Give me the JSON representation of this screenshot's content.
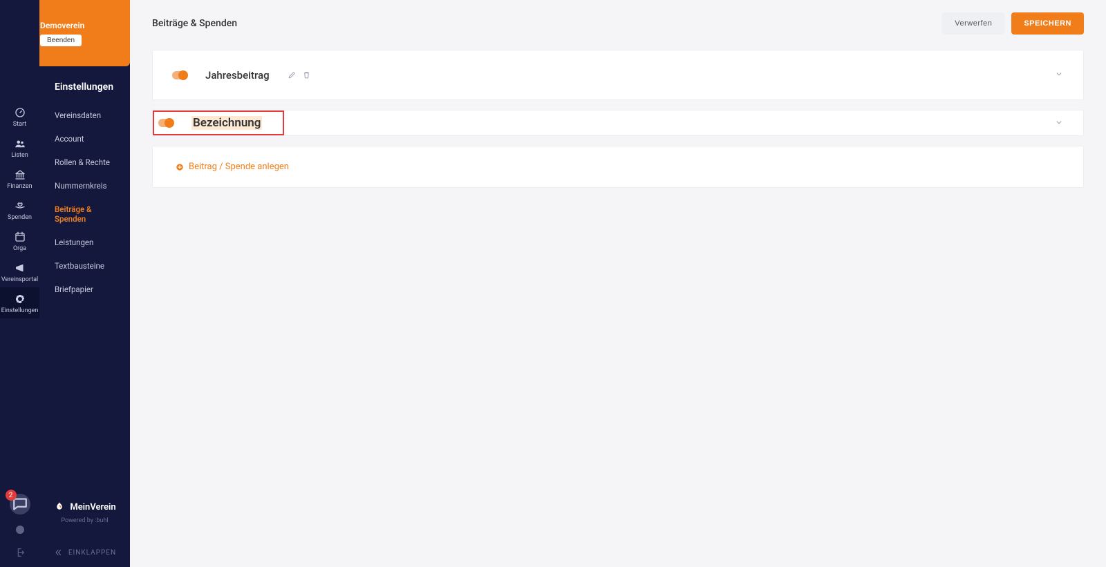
{
  "org": {
    "name": "Demoverein",
    "exit_label": "Beenden"
  },
  "rail": {
    "items": [
      {
        "id": "start",
        "label": "Start"
      },
      {
        "id": "listen",
        "label": "Listen"
      },
      {
        "id": "finanzen",
        "label": "Finanzen"
      },
      {
        "id": "spenden",
        "label": "Spenden"
      },
      {
        "id": "orga",
        "label": "Orga"
      },
      {
        "id": "portal",
        "label": "Vereinsportal"
      },
      {
        "id": "einstellungen",
        "label": "Einstellungen"
      }
    ],
    "notifications_count": "2"
  },
  "submenu": {
    "title": "Einstellungen",
    "items": [
      {
        "id": "vereinsdaten",
        "label": "Vereinsdaten"
      },
      {
        "id": "account",
        "label": "Account"
      },
      {
        "id": "rollen",
        "label": "Rollen & Rechte"
      },
      {
        "id": "nummernkreis",
        "label": "Nummernkreis"
      },
      {
        "id": "beitraege",
        "label": "Beiträge & Spenden",
        "active": true
      },
      {
        "id": "leistungen",
        "label": "Leistungen"
      },
      {
        "id": "textbausteine",
        "label": "Textbausteine"
      },
      {
        "id": "briefpapier",
        "label": "Briefpapier"
      }
    ],
    "brand": "MeinVerein",
    "powered": "Powered by :buhl",
    "collapse": "EINKLAPPEN"
  },
  "page": {
    "title": "Beiträge & Spenden",
    "discard": "Verwerfen",
    "save": "SPEICHERN"
  },
  "rows": [
    {
      "id": "jahresbeitrag",
      "title": "Jahresbeitrag",
      "has_actions": true
    },
    {
      "id": "bezeichnung",
      "title": "Bezeichnung",
      "highlight": true
    }
  ],
  "add_label": "Beitrag / Spende anlegen"
}
